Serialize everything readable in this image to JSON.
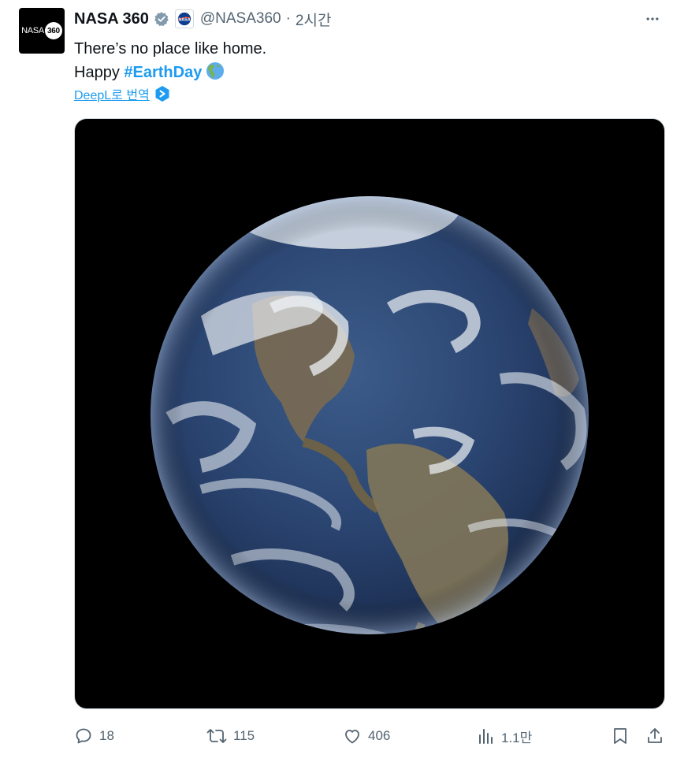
{
  "tweet": {
    "author": {
      "avatar_text": "NASA",
      "avatar_badge": "360",
      "name": "NASA 360",
      "handle": "@NASA360",
      "separator": "·",
      "time": "2시간"
    },
    "text_line1": "There’s no place like home.",
    "text_line2_prefix": "Happy ",
    "hashtag": "#EarthDay",
    "translate_label": "DeepL로 번역",
    "media_icon": "earth-photo",
    "actions": {
      "replies": "18",
      "reposts": "115",
      "likes": "406",
      "views": "1.1만"
    }
  },
  "colors": {
    "accent": "#1d9bf0",
    "secondary_text": "#536471",
    "verified": "#829aab"
  }
}
